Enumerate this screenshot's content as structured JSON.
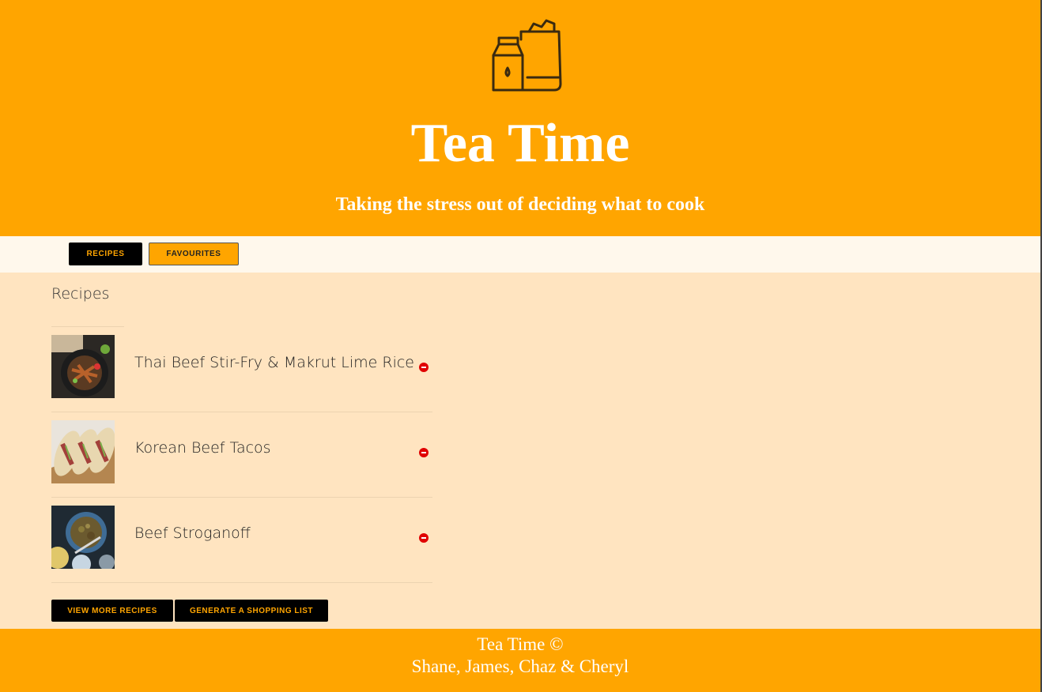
{
  "header": {
    "logo_icon": "grocery-bag-milk-icon",
    "title": "Tea Time",
    "tagline": "Taking the stress out of deciding what to cook"
  },
  "nav": {
    "recipes_label": "RECIPES",
    "favourites_label": "FAVOURITES"
  },
  "main": {
    "section_title": "Recipes",
    "recipes": [
      {
        "name": "Thai Beef Stir-Fry & Makrut Lime Rice"
      },
      {
        "name": "Korean Beef Tacos"
      },
      {
        "name": "Beef Stroganoff"
      }
    ],
    "view_more_label": "VIEW MORE RECIPES",
    "shopping_list_label": "GENERATE A SHOPPING LIST"
  },
  "footer": {
    "line1": "Tea Time ©",
    "line2": "Shane, James, Chaz & Cheryl"
  },
  "colors": {
    "brand_orange": "#ffa500",
    "page_background": "#ffe4c0",
    "nav_background": "#fff8ec",
    "remove_red": "#e00000"
  }
}
